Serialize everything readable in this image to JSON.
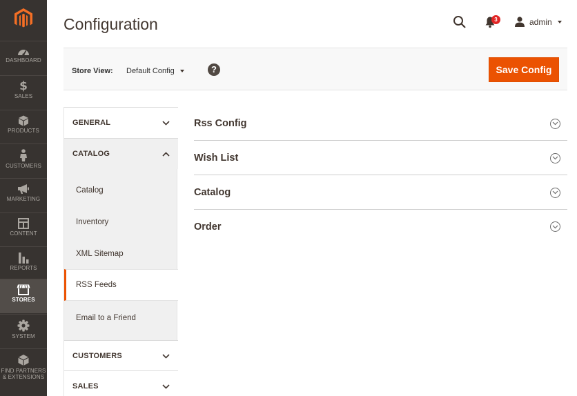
{
  "menu": {
    "items": [
      {
        "label": "DASHBOARD",
        "icon": "dashboard-icon"
      },
      {
        "label": "SALES",
        "icon": "dollar-icon"
      },
      {
        "label": "PRODUCTS",
        "icon": "cube-icon"
      },
      {
        "label": "CUSTOMERS",
        "icon": "person-icon"
      },
      {
        "label": "MARKETING",
        "icon": "megaphone-icon"
      },
      {
        "label": "CONTENT",
        "icon": "layout-icon"
      },
      {
        "label": "REPORTS",
        "icon": "bar-chart-icon"
      },
      {
        "label": "STORES",
        "icon": "store-icon"
      },
      {
        "label": "SYSTEM",
        "icon": "gear-icon"
      },
      {
        "label_line1": "FIND PARTNERS",
        "label_line2": "& EXTENSIONS",
        "icon": "extensions-icon"
      }
    ],
    "active": "STORES"
  },
  "header": {
    "title": "Configuration",
    "notifications_count": "3",
    "user_name": "admin"
  },
  "store_view": {
    "label": "Store View:",
    "value": "Default Config",
    "help_glyph": "?",
    "save_label": "Save Config"
  },
  "tabs": {
    "general": "GENERAL",
    "catalog": "CATALOG",
    "catalog_items": [
      "Catalog",
      "Inventory",
      "XML Sitemap",
      "RSS Feeds",
      "Email to a Friend"
    ],
    "active_item": "RSS Feeds",
    "customers": "CUSTOMERS",
    "sales": "SALES"
  },
  "sections": [
    "Rss Config",
    "Wish List",
    "Catalog",
    "Order"
  ],
  "colors": {
    "accent": "#eb5202",
    "sidebar": "#373330",
    "badge": "#e22626"
  }
}
